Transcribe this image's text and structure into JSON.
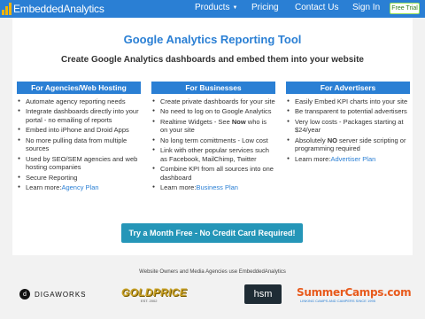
{
  "nav": {
    "logo_text": "EmbeddedAnalytics",
    "products_label": "Products",
    "pricing_label": "Pricing",
    "contact_label": "Contact Us",
    "signin_label": "Sign In",
    "free_trial_label": "Free Trial"
  },
  "main": {
    "title": "Google Analytics Reporting Tool",
    "subtitle": "Create Google Analytics dashboards and embed them into your website",
    "cta_label": "Try a Month Free - No Credit Card Required!"
  },
  "columns": [
    {
      "heading": "For Agencies/Web Hosting",
      "items": [
        "Automate agency reporting needs",
        "Integrate dashboards directly into your portal - no emailing of reports",
        "Embed into iPhone and Droid Apps",
        "No more pulling data from multiple sources",
        "Used by SEO/SEM agencies and web hosting companies",
        "Secure Reporting"
      ],
      "learn_more_prefix": "Learn more:",
      "learn_more_link": "Agency Plan"
    },
    {
      "heading": "For Businesses",
      "items": [
        "Create private dashboards for your site",
        "No need to log on to Google Analytics"
      ],
      "realtime_prefix": "Realtime Widgets - See ",
      "realtime_bold": "Now",
      "realtime_suffix": " who is on your site",
      "items_after": [
        "No long term comittments - Low cost",
        "Link with other popular services such as Facebook, MailChimp, Twitter",
        "Combine KPI from all sources into one dashboard"
      ],
      "learn_more_prefix": "Learn more:",
      "learn_more_link": "Business Plan"
    },
    {
      "heading": "For Advertisers",
      "items": [
        "Easily Embed KPI charts into your site",
        "Be transparent to potential advertisers",
        "Very low costs - Packages starting at $24/year"
      ],
      "absolutely_prefix": "Absolutely ",
      "absolutely_bold": "NO",
      "absolutely_suffix": " server side scripting or programming required",
      "learn_more_prefix": "Learn more:",
      "learn_more_link": "Advertiser Plan"
    }
  ],
  "partners": {
    "caption": "Website Owners and Media Agencies use EmbeddedAnalytics",
    "logos": [
      "DIGAWORKS",
      "GOLDPRICE",
      "EST. 2002",
      "hsm",
      "SummerCamps.com",
      "LINKING CAMPS AND CAMPERS SINCE 1995"
    ]
  },
  "colors": {
    "brand_blue": "#2a7fd4",
    "cta_teal": "#2596b8",
    "page_bg": "#f2f2f2"
  }
}
